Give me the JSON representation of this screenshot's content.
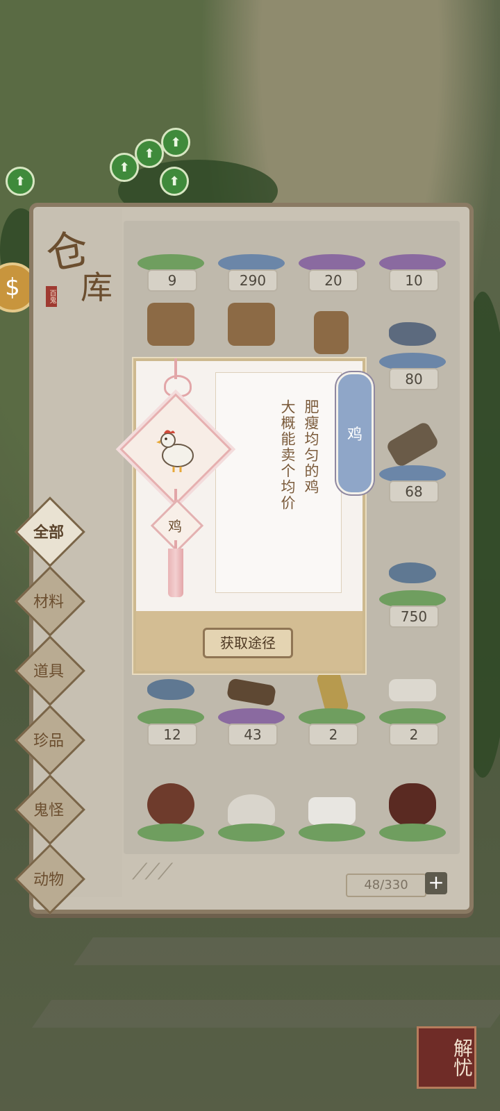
{
  "panel": {
    "title_char_1": "仓",
    "title_char_2": "库",
    "seal_text": "百鬼"
  },
  "tabs": [
    {
      "label": "全部",
      "active": true
    },
    {
      "label": "材料",
      "active": false
    },
    {
      "label": "道具",
      "active": false
    },
    {
      "label": "珍品",
      "active": false
    },
    {
      "label": "鬼怪",
      "active": false
    },
    {
      "label": "动物",
      "active": false
    }
  ],
  "items_row1": [
    {
      "count": "9",
      "icon": "sprout-icon",
      "base": "green"
    },
    {
      "count": "290",
      "icon": "blue-item-icon",
      "base": "blue"
    },
    {
      "count": "20",
      "icon": "box-icon",
      "base": "purple"
    },
    {
      "count": "10",
      "icon": "box-icon",
      "base": "purple"
    }
  ],
  "items_right": [
    {
      "count": "80",
      "icon": "fish-icon",
      "base": "blue"
    },
    {
      "count": "68",
      "icon": "hammer-icon",
      "base": "blue"
    },
    {
      "count": "750",
      "icon": "fish-icon",
      "base": "green"
    }
  ],
  "items_row5": [
    {
      "count": "12",
      "icon": "fish-icon",
      "base": "green"
    },
    {
      "count": "43",
      "icon": "egg-tray-icon",
      "base": "purple"
    },
    {
      "count": "2",
      "icon": "talisman-icon",
      "base": "green"
    },
    {
      "count": "2",
      "icon": "tofu-icon",
      "base": "green"
    }
  ],
  "inventory": {
    "counter": "48/330",
    "add_label": "+"
  },
  "popup": {
    "item_name": "鸡",
    "tag_label": "鸡",
    "desc_line1": "肥瘦均匀的鸡",
    "desc_line2": "大概能卖个均价",
    "button_label": "获取途径"
  },
  "corner_button": "解忧",
  "colors": {
    "green": "#6f9e5f",
    "blue": "#6b86a8",
    "purple": "#8a6aa0"
  }
}
